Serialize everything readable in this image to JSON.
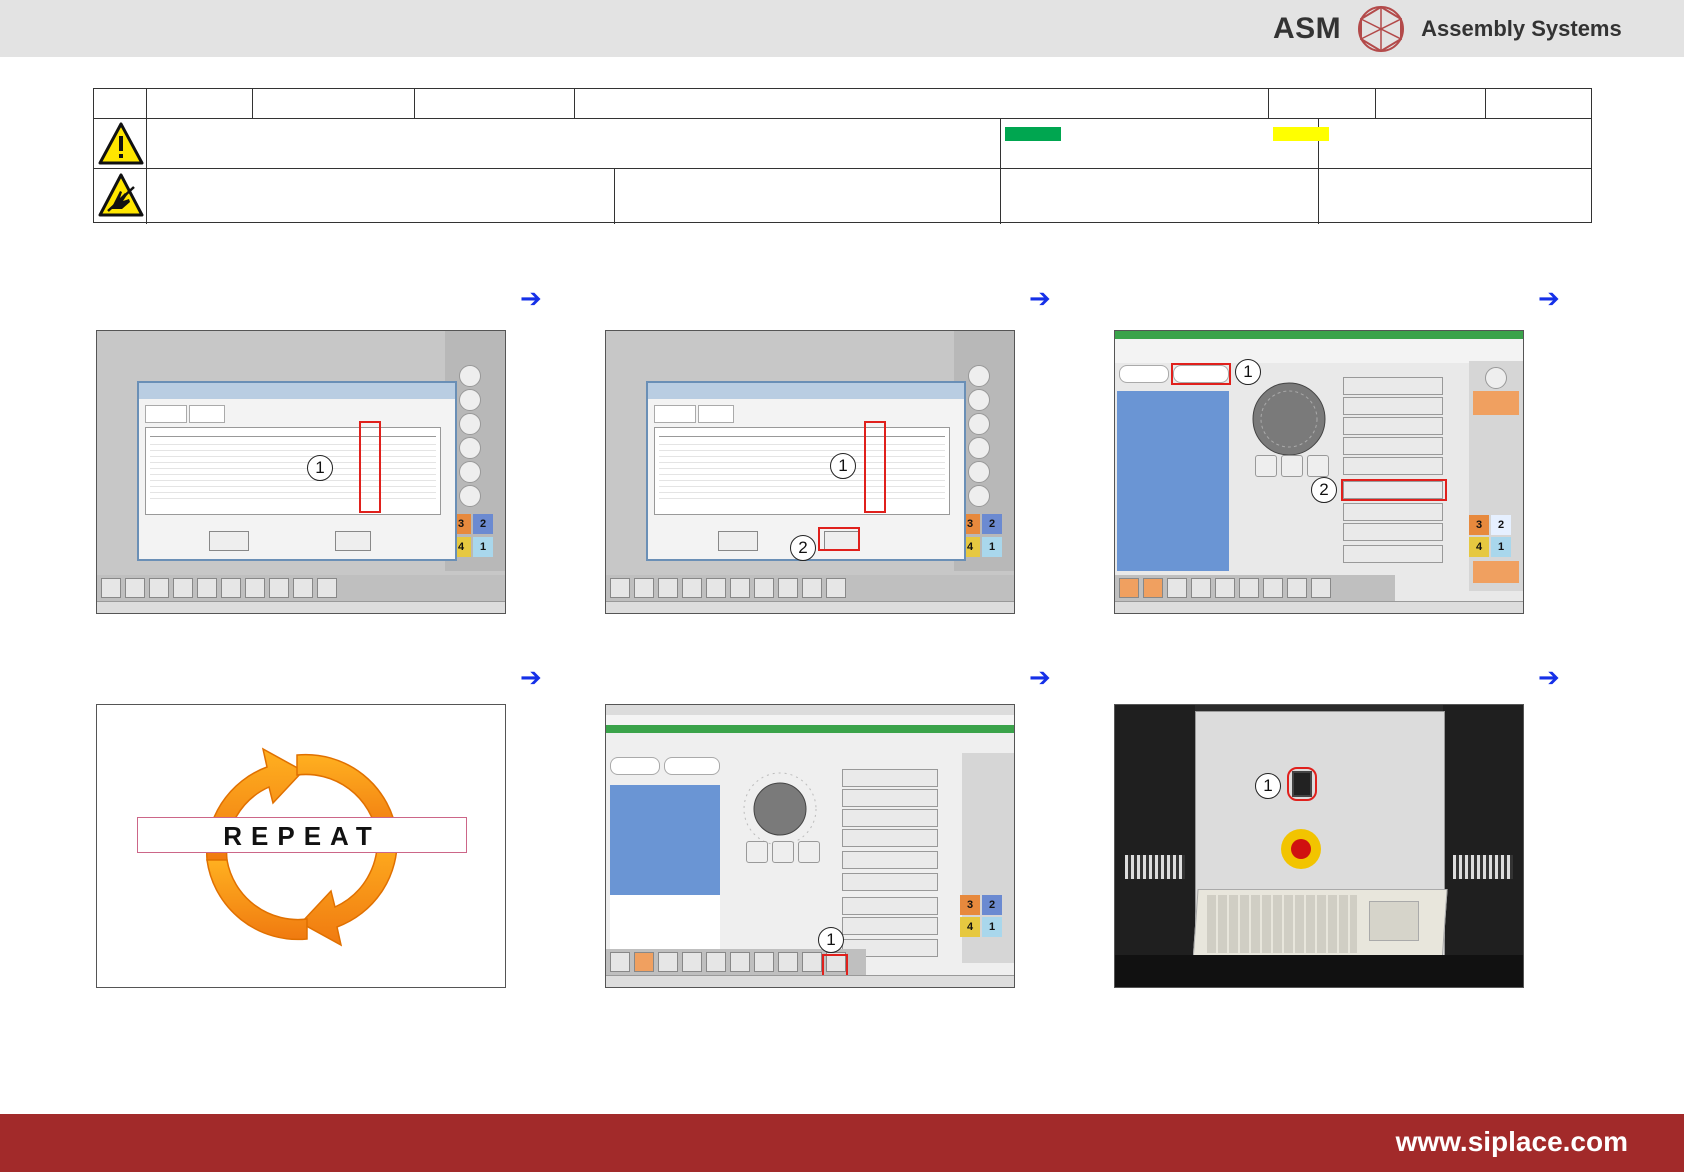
{
  "brand": {
    "name": "ASM",
    "tagline": "Assembly Systems"
  },
  "footer": {
    "url": "www.siplace.com"
  },
  "colors": {
    "brand_red": "#a22a2a",
    "arrow_blue": "#1530e8",
    "status_green": "#00a650",
    "status_yellow": "#ffff00",
    "callout_red": "#e0201c"
  },
  "icons": {
    "warning": "warning-triangle-icon",
    "esd": "esd-hand-icon",
    "next": "arrow-right-icon"
  },
  "steps": [
    {
      "callouts": [
        "1"
      ]
    },
    {
      "callouts": [
        "1",
        "2"
      ]
    },
    {
      "callouts": [
        "1",
        "2"
      ]
    },
    {
      "label": "REPEAT"
    },
    {
      "callouts": [
        "1"
      ]
    },
    {
      "callouts": [
        "1"
      ]
    }
  ]
}
